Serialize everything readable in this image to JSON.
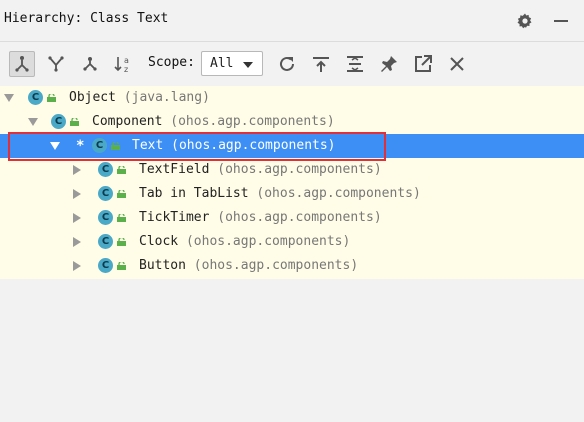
{
  "title": "Hierarchy:  Class Text",
  "toolbar": {
    "scope_label": "Scope:",
    "scope_value": "All"
  },
  "tree": [
    {
      "name": "Object",
      "pkg": "(java.lang)"
    },
    {
      "name": "Component",
      "pkg": "(ohos.agp.components)"
    },
    {
      "name": "Text",
      "pkg": "(ohos.agp.components)",
      "marker": "*"
    },
    {
      "name": "TextField",
      "pkg": "(ohos.agp.components)"
    },
    {
      "name": "Tab in TabList",
      "pkg": "(ohos.agp.components)"
    },
    {
      "name": "TickTimer",
      "pkg": "(ohos.agp.components)"
    },
    {
      "name": "Clock",
      "pkg": "(ohos.agp.components)"
    },
    {
      "name": "Button",
      "pkg": "(ohos.agp.components)"
    }
  ],
  "icons": {
    "class": "C",
    "class_color": "#4ba9c8",
    "lock_color": "#5bb04c",
    "selection_color": "#3d8ff5",
    "highlight_color": "#e0303a"
  }
}
